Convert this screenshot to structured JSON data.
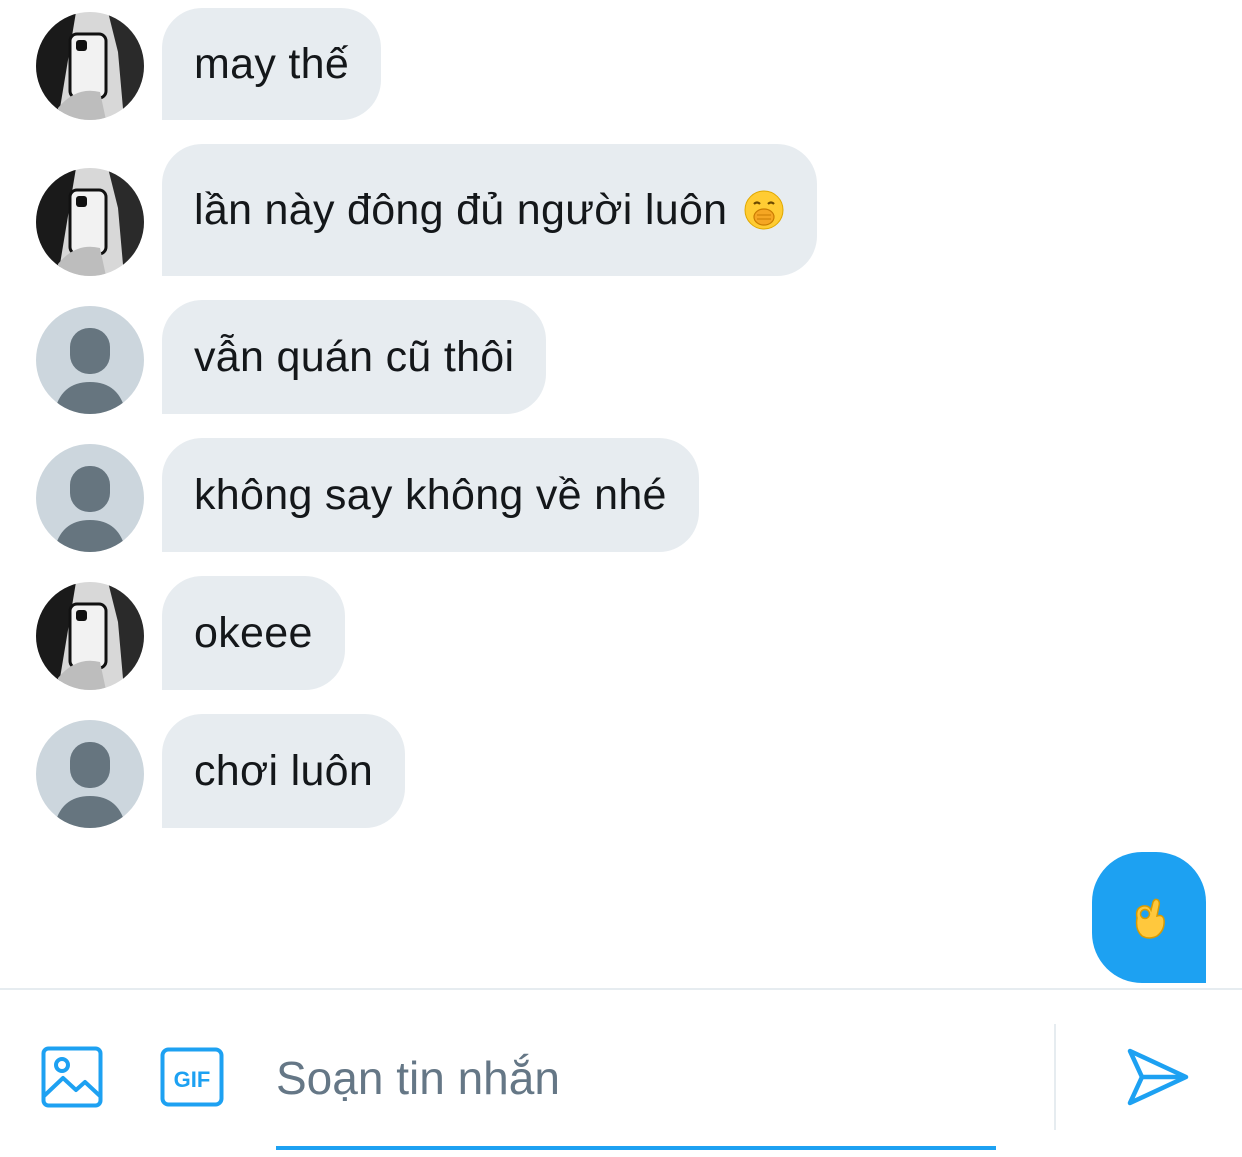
{
  "conversation": {
    "messages": [
      {
        "sender": "friend",
        "avatar": "photo-avatar",
        "text": "may thế"
      },
      {
        "sender": "friend",
        "avatar": "photo-avatar",
        "text": "lần này đông đủ người luôn",
        "emoji": "face-with-hand-over-mouth-emoji"
      },
      {
        "sender": "other",
        "avatar": "default-avatar",
        "text": "vẫn quán cũ thôi"
      },
      {
        "sender": "other",
        "avatar": "default-avatar",
        "text": "không say không về nhé"
      },
      {
        "sender": "friend",
        "avatar": "photo-avatar",
        "text": "okeee"
      },
      {
        "sender": "other",
        "avatar": "default-avatar",
        "text": "chơi luôn"
      }
    ],
    "sent_message": {
      "emoji": "ok-hand-emoji"
    }
  },
  "composer": {
    "placeholder": "Soạn tin nhắn",
    "value": "",
    "media_icon": "image-icon",
    "gif_icon": "gif-icon",
    "gif_label": "GIF",
    "send_icon": "send-icon"
  },
  "colors": {
    "received_bubble": "#e7ecf0",
    "sent_bubble": "#1da1f2",
    "accent": "#1da1f2",
    "text": "#14171a",
    "placeholder": "#657786",
    "default_avatar_bg": "#ccd6dd",
    "default_avatar_fg": "#66757f"
  }
}
